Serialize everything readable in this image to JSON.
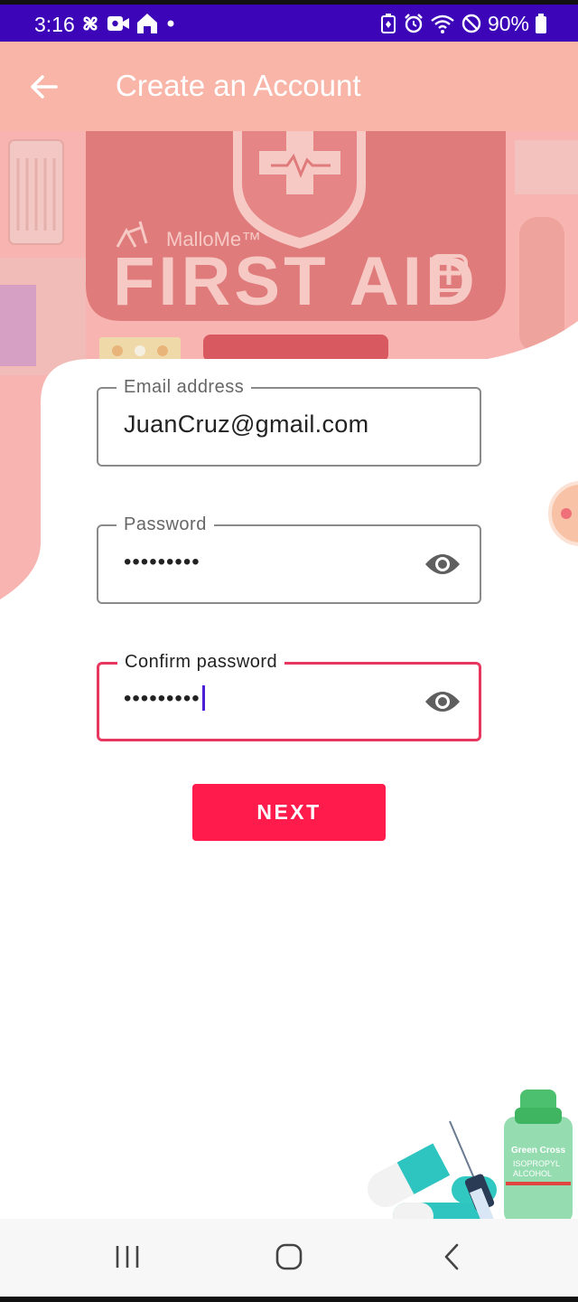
{
  "status_bar": {
    "time": "3:16",
    "left_icons": [
      "pinwheel-icon",
      "video-call-icon",
      "home-icon",
      "dot-icon"
    ],
    "right_icons": [
      "battery-saver-icon",
      "alarm-icon",
      "wifi-icon",
      "do-not-disturb-icon",
      "battery-icon"
    ],
    "battery": "90%"
  },
  "app_bar": {
    "title": "Create an Account",
    "back_icon": "arrow-left-icon"
  },
  "hero": {
    "brand_text": "MalloMe™",
    "kit_text": "FIRST AID",
    "colors": {
      "overlay": "#f8b4b0",
      "kit": "#e07878"
    }
  },
  "form": {
    "email": {
      "label": "Email address",
      "value": "JuanCruz@gmail.com"
    },
    "password": {
      "label": "Password",
      "value": "•••••••••",
      "icon": "eye-icon"
    },
    "confirm": {
      "label": "Confirm password",
      "value": "•••••••••",
      "icon": "eye-icon"
    }
  },
  "actions": {
    "next_label": "NEXT"
  },
  "bottom_image": {
    "bottle_brand": "Green Cross",
    "bottle_line1": "ISOPROPYL",
    "bottle_line2": "ALCOHOL"
  },
  "nav_bar": {
    "icons": [
      "recent-apps-icon",
      "home-icon",
      "back-icon"
    ]
  },
  "colors": {
    "status_bar": "#3c05b8",
    "app_bar": "#f9b5a8",
    "accent": "#ff1c4d",
    "focus_border": "#e8365e",
    "caret": "#4c1fd6"
  }
}
